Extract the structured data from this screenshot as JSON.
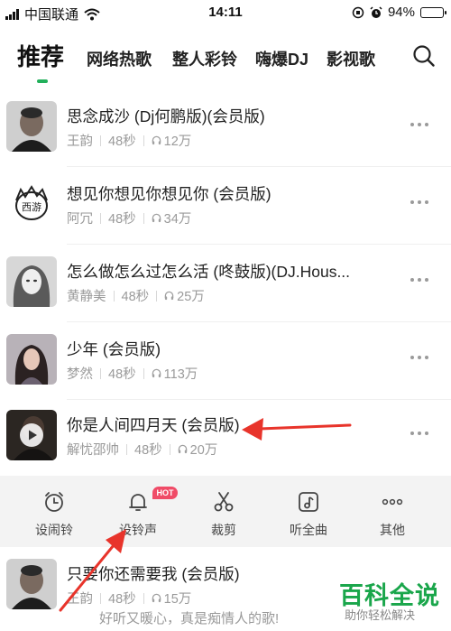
{
  "status_bar": {
    "carrier": "中国联通",
    "time": "14:11",
    "battery": "94%",
    "battery_level": 0.94
  },
  "tabs": [
    {
      "label": "推荐",
      "active": true
    },
    {
      "label": "网络热歌",
      "active": false
    },
    {
      "label": "整人彩铃",
      "active": false
    },
    {
      "label": "嗨爆DJ",
      "active": false
    },
    {
      "label": "影视歌",
      "active": false
    }
  ],
  "songs": [
    {
      "title": "思念成沙 (Dj何鹏版)(会员版)",
      "artist": "王韵",
      "duration": "48秒",
      "plays": "12万"
    },
    {
      "title": "想见你想见你想见你 (会员版)",
      "artist": "阿冗",
      "duration": "48秒",
      "plays": "34万"
    },
    {
      "title": "怎么做怎么过怎么活 (咚鼓版)(DJ.Hous...",
      "artist": "黄静美",
      "duration": "48秒",
      "plays": "25万"
    },
    {
      "title": "少年 (会员版)",
      "artist": "梦然",
      "duration": "48秒",
      "plays": "113万"
    },
    {
      "title": "你是人间四月天 (会员版)",
      "artist": "解忧邵帅",
      "duration": "48秒",
      "plays": "20万",
      "playing": true
    },
    {
      "title": "只要你还需要我 (会员版)",
      "artist": "王韵",
      "duration": "48秒",
      "plays": "15万"
    }
  ],
  "actions": [
    {
      "label": "设闹铃",
      "icon": "alarm-clock-icon"
    },
    {
      "label": "设铃声",
      "icon": "bell-icon"
    },
    {
      "label": "裁剪",
      "icon": "scissors-icon"
    },
    {
      "label": "听全曲",
      "icon": "music-note-icon"
    },
    {
      "label": "其他",
      "icon": "more-dots-icon"
    }
  ],
  "hot_badge": "HOT",
  "caption": "好听又暖心，真是痴情人的歌!",
  "watermark": {
    "main": "百科全说",
    "sub": "助你轻松解决"
  },
  "colors": {
    "accent_green": "#22b05b",
    "hot_red": "#f04b67",
    "arrow_red": "#e8342b",
    "action_bg": "#f3f3f3"
  }
}
